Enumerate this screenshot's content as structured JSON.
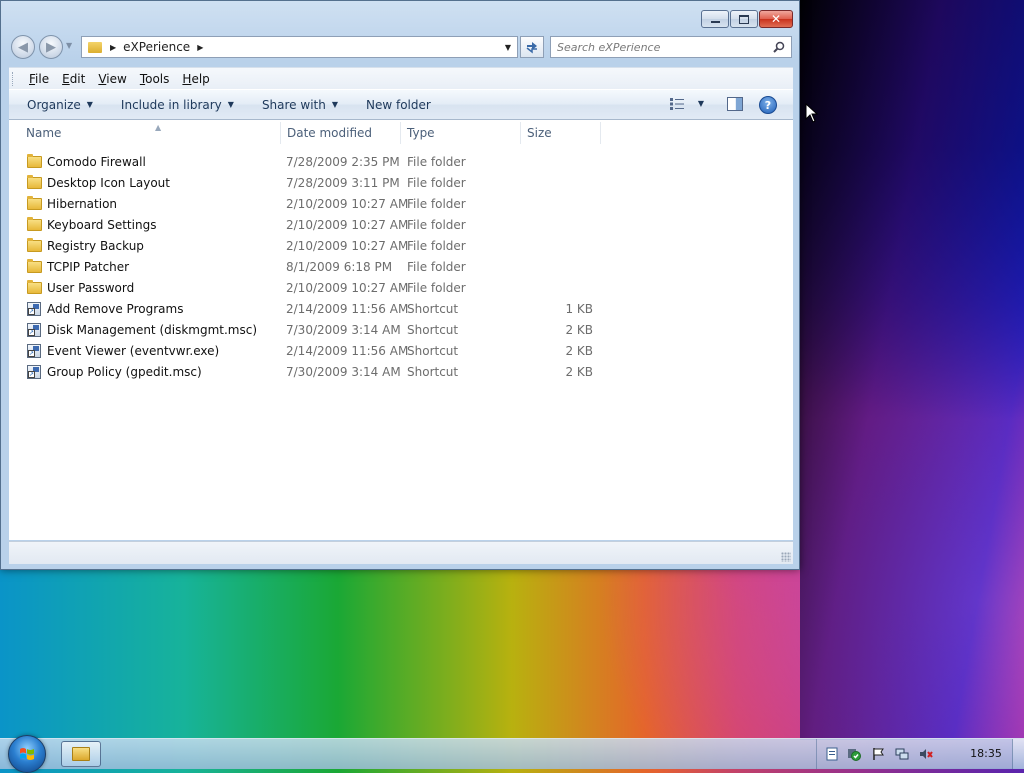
{
  "window": {
    "caption_buttons": {
      "minimize": "",
      "maximize": "",
      "close": "✕"
    }
  },
  "address_bar": {
    "path": "eXPerience",
    "search_placeholder": "Search eXPerience"
  },
  "menu": {
    "items": [
      {
        "label": "File",
        "accel": "F",
        "rest": "ile"
      },
      {
        "label": "Edit",
        "accel": "E",
        "rest": "dit"
      },
      {
        "label": "View",
        "accel": "V",
        "rest": "iew"
      },
      {
        "label": "Tools",
        "accel": "T",
        "rest": "ools"
      },
      {
        "label": "Help",
        "accel": "H",
        "rest": "elp"
      }
    ]
  },
  "commands": {
    "organize": "Organize",
    "include_in_library": "Include in library",
    "share_with": "Share with",
    "new_folder": "New folder"
  },
  "columns": {
    "name": "Name",
    "date_modified": "Date modified",
    "type": "Type",
    "size": "Size"
  },
  "files": [
    {
      "name": "Comodo Firewall",
      "date": "7/28/2009 2:35 PM",
      "type": "File folder",
      "size": "",
      "icon": "folder-icon"
    },
    {
      "name": "Desktop Icon Layout",
      "date": "7/28/2009 3:11 PM",
      "type": "File folder",
      "size": "",
      "icon": "folder-icon"
    },
    {
      "name": "Hibernation",
      "date": "2/10/2009 10:27 AM",
      "type": "File folder",
      "size": "",
      "icon": "folder-icon"
    },
    {
      "name": "Keyboard Settings",
      "date": "2/10/2009 10:27 AM",
      "type": "File folder",
      "size": "",
      "icon": "folder-icon"
    },
    {
      "name": "Registry Backup",
      "date": "2/10/2009 10:27 AM",
      "type": "File folder",
      "size": "",
      "icon": "folder-icon"
    },
    {
      "name": "TCPIP Patcher",
      "date": "8/1/2009 6:18 PM",
      "type": "File folder",
      "size": "",
      "icon": "folder-icon"
    },
    {
      "name": "User Password",
      "date": "2/10/2009 10:27 AM",
      "type": "File folder",
      "size": "",
      "icon": "folder-icon"
    },
    {
      "name": "Add Remove Programs",
      "date": "2/14/2009 11:56 AM",
      "type": "Shortcut",
      "size": "1 KB",
      "icon": "shortcut-icon"
    },
    {
      "name": "Disk Management (diskmgmt.msc)",
      "date": "7/30/2009 3:14 AM",
      "type": "Shortcut",
      "size": "2 KB",
      "icon": "shortcut-icon"
    },
    {
      "name": "Event Viewer (eventvwr.exe)",
      "date": "2/14/2009 11:56 AM",
      "type": "Shortcut",
      "size": "2 KB",
      "icon": "shortcut-icon"
    },
    {
      "name": "Group Policy (gpedit.msc)",
      "date": "7/30/2009 3:14 AM",
      "type": "Shortcut",
      "size": "2 KB",
      "icon": "shortcut-icon"
    }
  ],
  "taskbar": {
    "clock": "18:35"
  }
}
